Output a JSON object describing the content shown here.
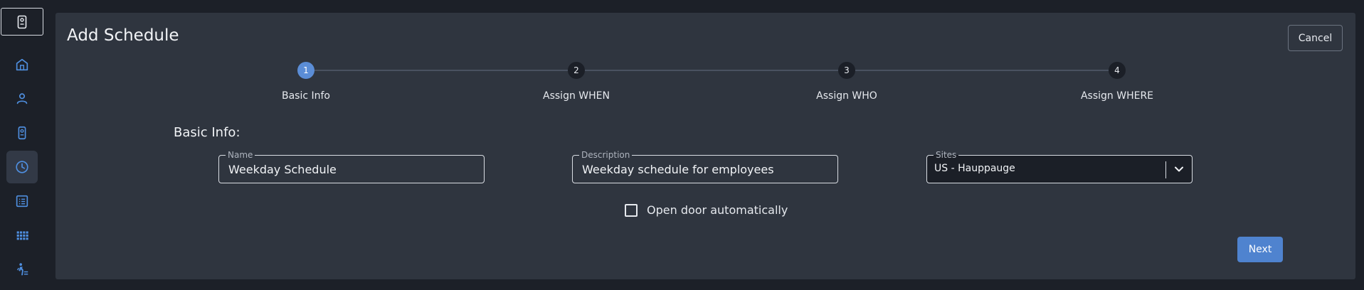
{
  "sidebar": {
    "logo_icon": "intercom-device-icon",
    "items": [
      {
        "icon": "home-icon",
        "active": false
      },
      {
        "icon": "user-icon",
        "active": false
      },
      {
        "icon": "intercom-device-icon",
        "active": false
      },
      {
        "icon": "clock-icon",
        "active": true
      },
      {
        "icon": "list-icon",
        "active": false
      },
      {
        "icon": "grid-icon",
        "active": false
      },
      {
        "icon": "person-walking-icon",
        "active": false
      }
    ]
  },
  "header": {
    "title": "Add Schedule",
    "cancel_label": "Cancel"
  },
  "stepper": {
    "steps": [
      {
        "number": "1",
        "label": "Basic Info",
        "active": true
      },
      {
        "number": "2",
        "label": "Assign WHEN",
        "active": false
      },
      {
        "number": "3",
        "label": "Assign WHO",
        "active": false
      },
      {
        "number": "4",
        "label": "Assign WHERE",
        "active": false
      }
    ]
  },
  "form": {
    "section_title": "Basic Info:",
    "name": {
      "label": "Name",
      "value": "Weekday Schedule"
    },
    "description": {
      "label": "Description",
      "value": "Weekday schedule for employees"
    },
    "sites": {
      "label": "Sites",
      "value": "US - Hauppauge"
    },
    "open_door": {
      "label": "Open door automatically",
      "checked": false
    },
    "next_label": "Next"
  },
  "colors": {
    "accent": "#5b8dd6",
    "panel": "#2f353f",
    "background": "#1c2028"
  }
}
